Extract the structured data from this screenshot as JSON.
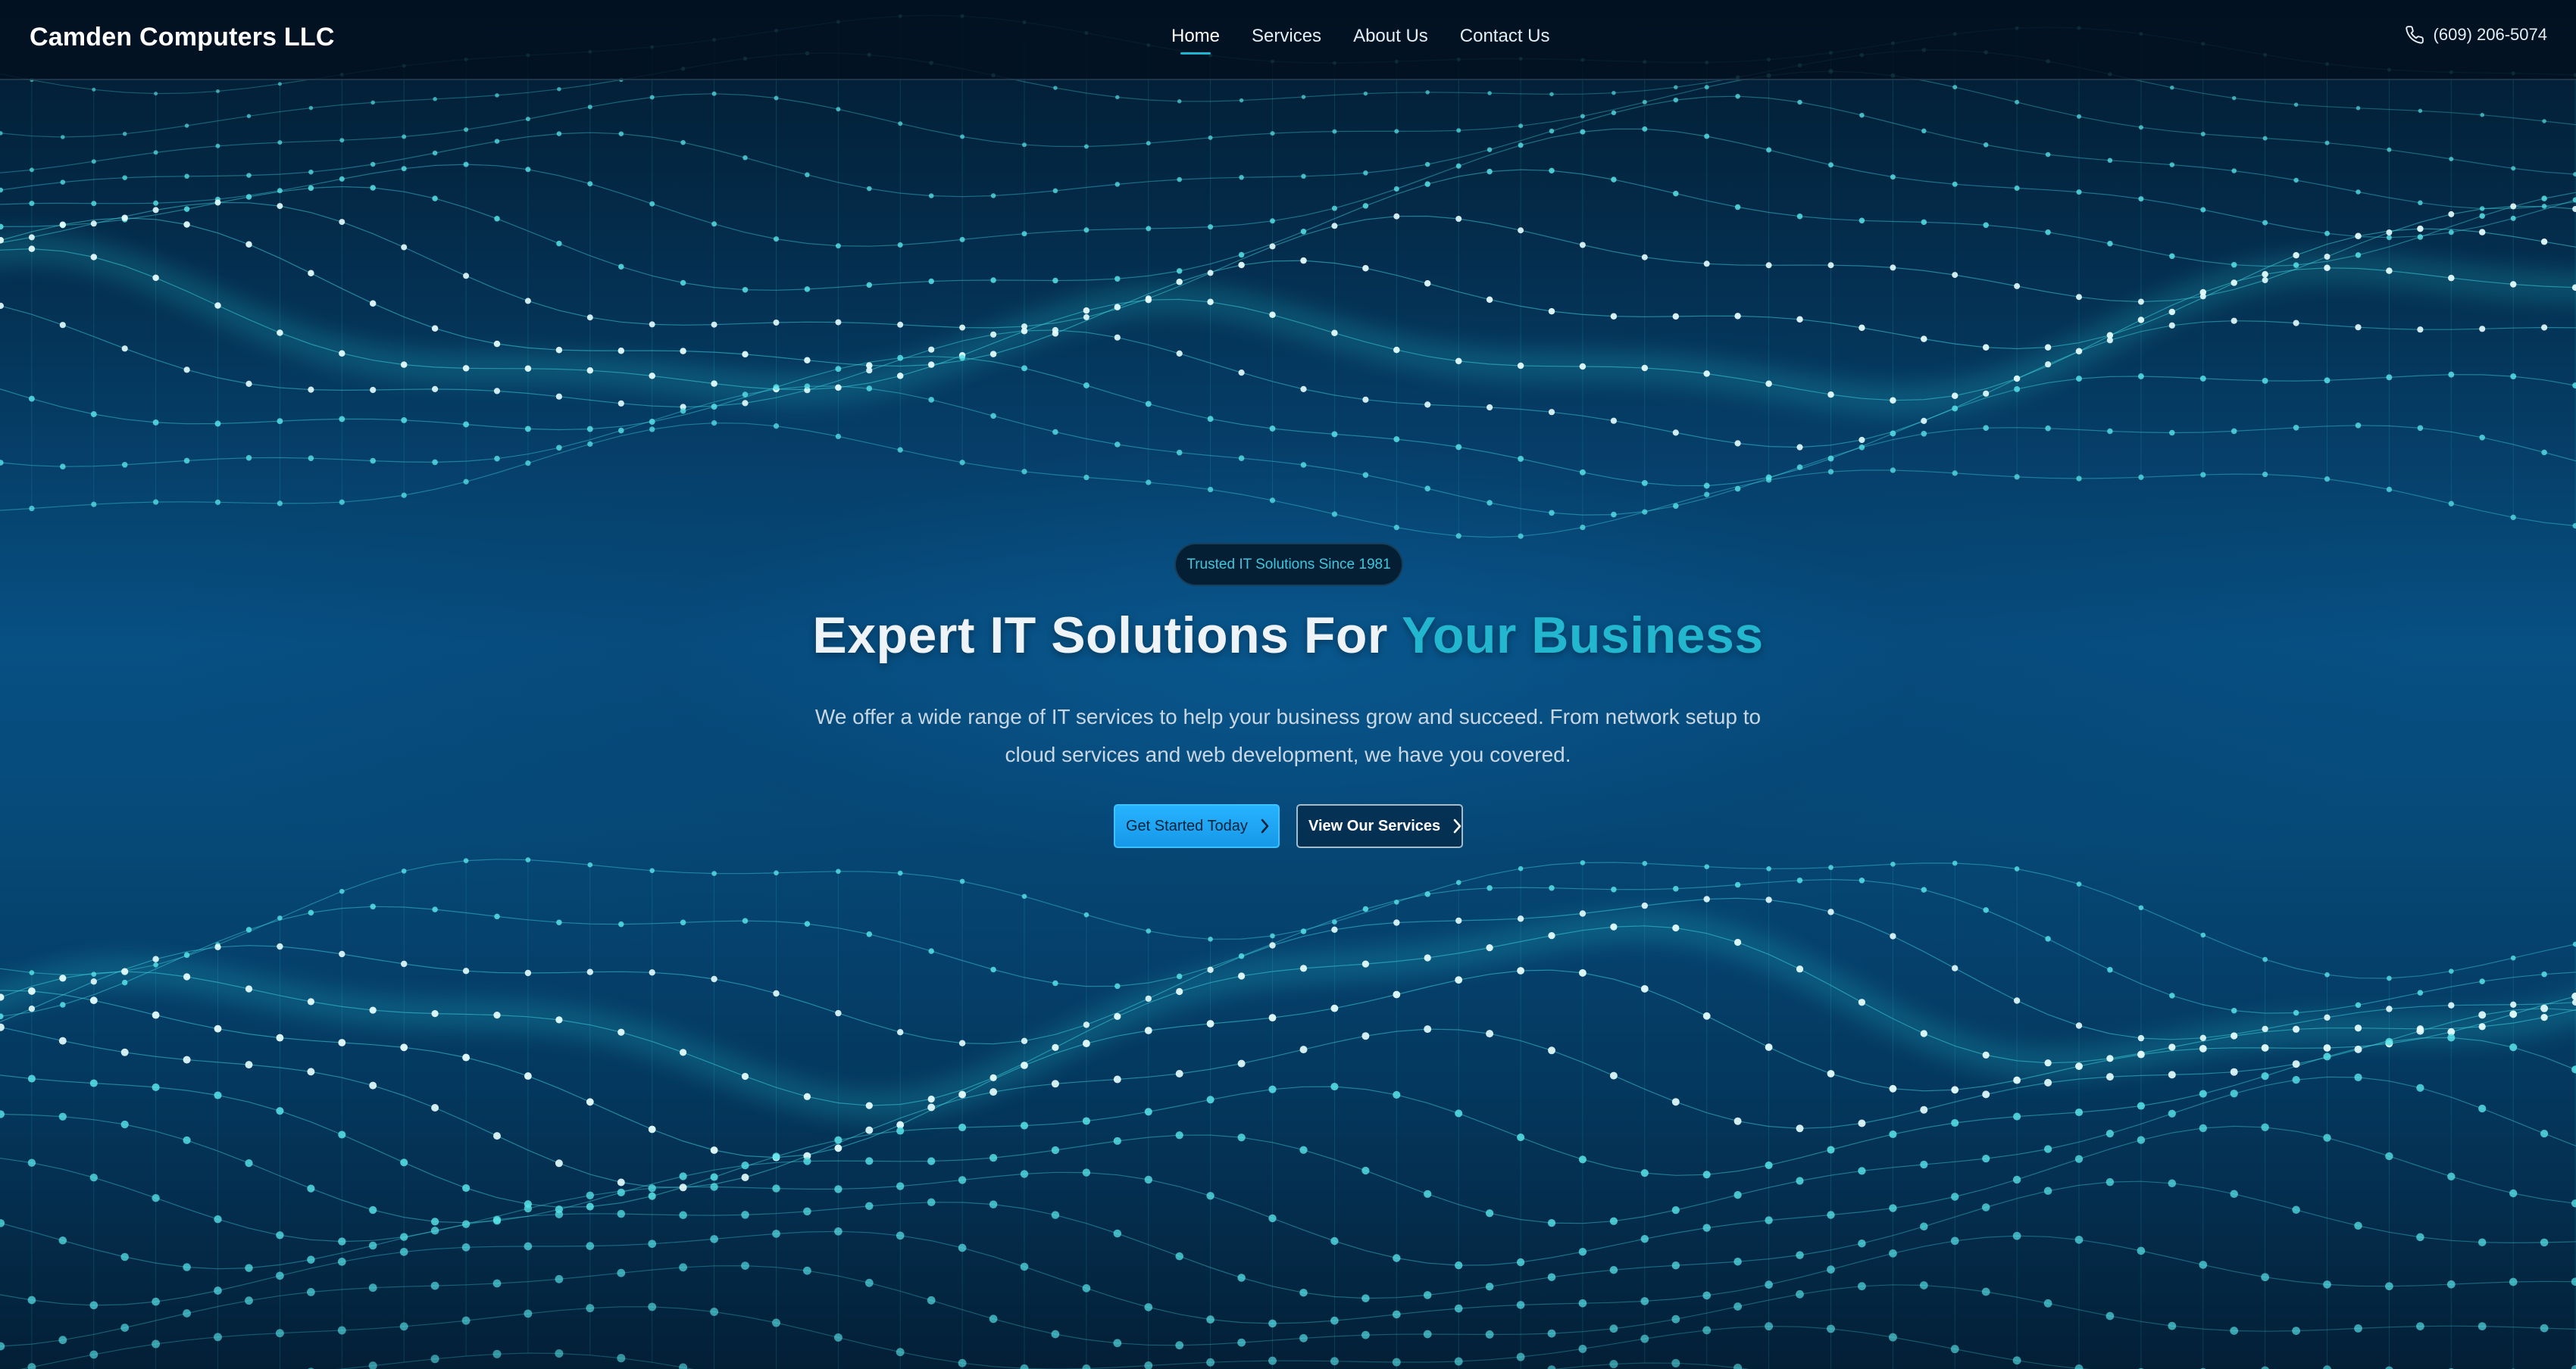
{
  "brand": {
    "name": "Camden Computers LLC"
  },
  "nav": {
    "items": [
      {
        "label": "Home",
        "active": true
      },
      {
        "label": "Services",
        "active": false
      },
      {
        "label": "About Us",
        "active": false
      },
      {
        "label": "Contact Us",
        "active": false
      }
    ],
    "phone": {
      "icon": "phone-icon",
      "text": "(609) 206-5074"
    }
  },
  "hero": {
    "badge": "Trusted IT Solutions Since 1981",
    "headline_main": "Expert IT Solutions For ",
    "headline_accent": "Your Business",
    "description_line1": "We offer a wide range of IT services to help your business grow and succeed. From network setup to",
    "description_line2": "cloud services and web development, we have you covered.",
    "primary_cta": {
      "label": "Get Started Today",
      "icon": "chevron-right-icon"
    },
    "secondary_cta": {
      "label": "View Our Services",
      "icon": "chevron-right-icon"
    }
  },
  "colors": {
    "accent": "#22b6cf",
    "primary_button": "#1fa6f5",
    "background": "#04304f",
    "nav_background": "#02101e"
  }
}
